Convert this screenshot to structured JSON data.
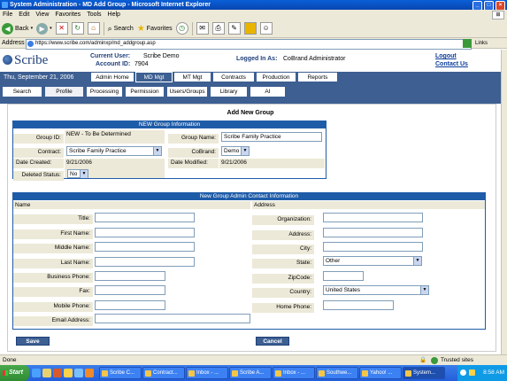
{
  "window": {
    "title": "System Administration - MD Add Group - Microsoft Internet Explorer"
  },
  "menu": [
    "File",
    "Edit",
    "View",
    "Favorites",
    "Tools",
    "Help"
  ],
  "toolbar": {
    "back": "Back",
    "search": "Search",
    "favorites": "Favorites"
  },
  "address": {
    "label": "Address",
    "url": "https://www.scribe.com/adminxp/md_addgroup.asp",
    "links": "Links"
  },
  "header": {
    "logo": "Scribe",
    "current_user_label": "Current User:",
    "current_user": "Scribe Demo",
    "account_label": "Account ID:",
    "account_id": "7904",
    "logged_in_label": "Logged In As:",
    "logged_in": "CoBrand Administrator",
    "logout": "Logout",
    "contact": "Contact Us"
  },
  "date": "Thu, September 21, 2006",
  "top_tabs": [
    "Admin Home",
    "MD Mgt",
    "MT Mgt",
    "Contracts",
    "Production",
    "Reports"
  ],
  "sub_tabs": [
    "Search",
    "Profile",
    "Processing",
    "Permission",
    "Users/Groups",
    "Library",
    "AI"
  ],
  "page_title": "Add New Group",
  "group_info": {
    "section": "NEW Group Information",
    "group_id_label": "Group ID:",
    "group_id": "NEW - To Be Determined",
    "group_name_label": "Group Name:",
    "group_name": "Scribe Family Practice",
    "contract_label": "Contract:",
    "contract": "Scribe Family Practice",
    "cobrand_label": "CoBrand:",
    "cobrand": "Demo",
    "date_created_label": "Date Created:",
    "date_created": "9/21/2006",
    "date_modified_label": "Date Modified:",
    "date_modified": "9/21/2006",
    "deleted_label": "Deleted Status:",
    "deleted": "No"
  },
  "admin_contact": {
    "section": "New Group Admin Contact Information",
    "name_col": "Name",
    "address_col": "Address",
    "left_fields": [
      "Title:",
      "First Name:",
      "Middle Name:",
      "Last Name:",
      "Business Phone:",
      "Fax:",
      "Mobile Phone:",
      "Email Address:"
    ],
    "right_fields": [
      "Organization:",
      "Address:",
      "City:",
      "State:",
      "ZipCode:",
      "Country:",
      "Home Phone:"
    ],
    "state": "Other",
    "country": "United States"
  },
  "buttons": {
    "save": "Save",
    "cancel": "Cancel"
  },
  "status": {
    "left": "Done",
    "right": "Trusted sites"
  },
  "taskbar": {
    "start": "Start",
    "tasks": [
      "Scribe C...",
      "Contract...",
      "Inbox - ...",
      "Scribe A...",
      "Inbox - ...",
      "Southwe...",
      "Yahoo! ...",
      "System..."
    ],
    "clock": "8:58 AM"
  }
}
